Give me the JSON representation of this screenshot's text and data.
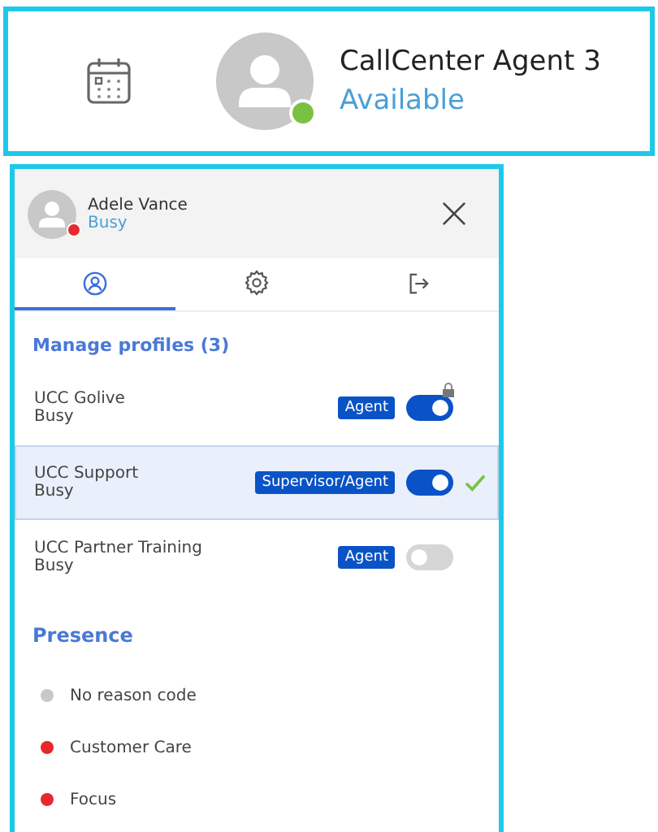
{
  "header": {
    "name": "CallCenter Agent 3",
    "status": "Available",
    "color": "#7ac143"
  },
  "panel": {
    "user": {
      "name": "Adele Vance",
      "status": "Busy",
      "color": "#e8272f"
    },
    "tabs": [
      {
        "kind": "person",
        "selected": true
      },
      {
        "kind": "gear",
        "selected": false
      },
      {
        "kind": "exit",
        "selected": false
      }
    ],
    "profiles_title": "Manage profiles (3)",
    "profiles": [
      {
        "name": "UCC Golive",
        "status": "Busy",
        "role": "Agent",
        "on": true,
        "locked": true,
        "selected": false
      },
      {
        "name": "UCC Support",
        "status": "Busy",
        "role": "Supervisor/Agent",
        "on": true,
        "locked": false,
        "selected": true
      },
      {
        "name": "UCC Partner Training",
        "status": "Busy",
        "role": "Agent",
        "on": false,
        "locked": false,
        "selected": false
      }
    ],
    "presence_title": "Presence",
    "presence": [
      {
        "label": "No reason code",
        "color": "#c8c8c8"
      },
      {
        "label": "Customer Care",
        "color": "#e8272f"
      },
      {
        "label": "Focus",
        "color": "#e8272f"
      }
    ]
  }
}
